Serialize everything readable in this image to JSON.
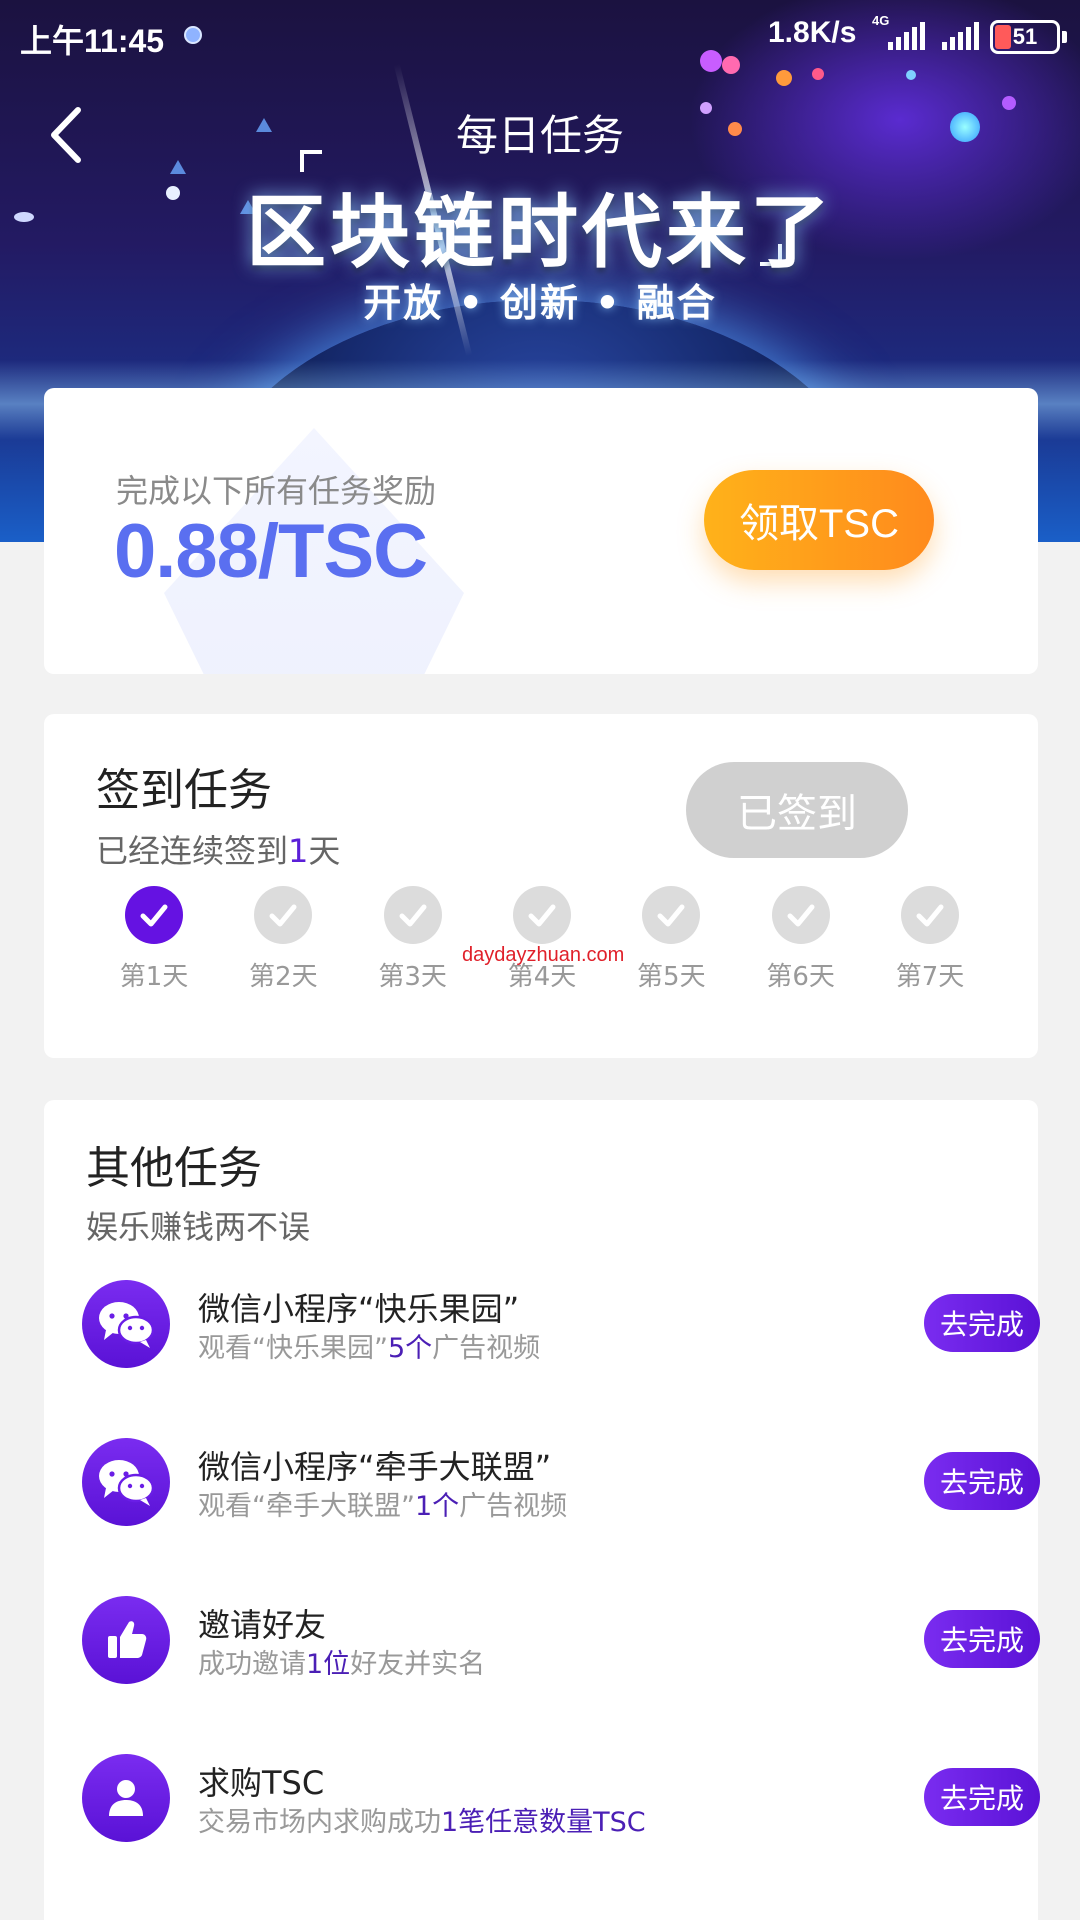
{
  "status_bar": {
    "time": "上午11:45",
    "speed": "1.8K/s",
    "network": "4G",
    "battery": "51"
  },
  "header": {
    "title": "每日任务"
  },
  "banner": {
    "slogan": "区块链时代来了",
    "sub": "开放 • 创新 • 融合"
  },
  "reward": {
    "label": "完成以下所有任务奖励",
    "value": "0.88/TSC",
    "button_label": "领取TSC"
  },
  "checkin": {
    "title": "签到任务",
    "subtitle_prefix": "已经连续签到",
    "subtitle_count": "1",
    "subtitle_suffix": "天",
    "button_label": "已签到",
    "days": [
      {
        "label": "第1天",
        "checked": true
      },
      {
        "label": "第2天",
        "checked": false
      },
      {
        "label": "第3天",
        "checked": false
      },
      {
        "label": "第4天",
        "checked": false
      },
      {
        "label": "第5天",
        "checked": false
      },
      {
        "label": "第6天",
        "checked": false
      },
      {
        "label": "第7天",
        "checked": false
      }
    ]
  },
  "watermark": "daydayzhuan.com",
  "other_tasks": {
    "title": "其他任务",
    "subtitle": "娱乐赚钱两不误",
    "items": [
      {
        "icon": "wechat-icon",
        "title": "微信小程序“快乐果园”",
        "desc_prefix": "观看“快乐果园”",
        "desc_highlight": "5个",
        "desc_suffix": "广告视频",
        "button_label": "去完成"
      },
      {
        "icon": "wechat-icon",
        "title": "微信小程序“牵手大联盟”",
        "desc_prefix": "观看“牵手大联盟”",
        "desc_highlight": "1个",
        "desc_suffix": "广告视频",
        "button_label": "去完成"
      },
      {
        "icon": "thumbs-up-icon",
        "title": "邀请好友",
        "desc_prefix": "成功邀请",
        "desc_highlight": "1位",
        "desc_suffix": "好友并实名",
        "button_label": "去完成"
      },
      {
        "icon": "user-icon",
        "title": "求购TSC",
        "desc_prefix": "交易市场内求购成功",
        "desc_highlight": "1笔任意数量TSC",
        "desc_suffix": "",
        "button_label": "去完成"
      }
    ]
  }
}
